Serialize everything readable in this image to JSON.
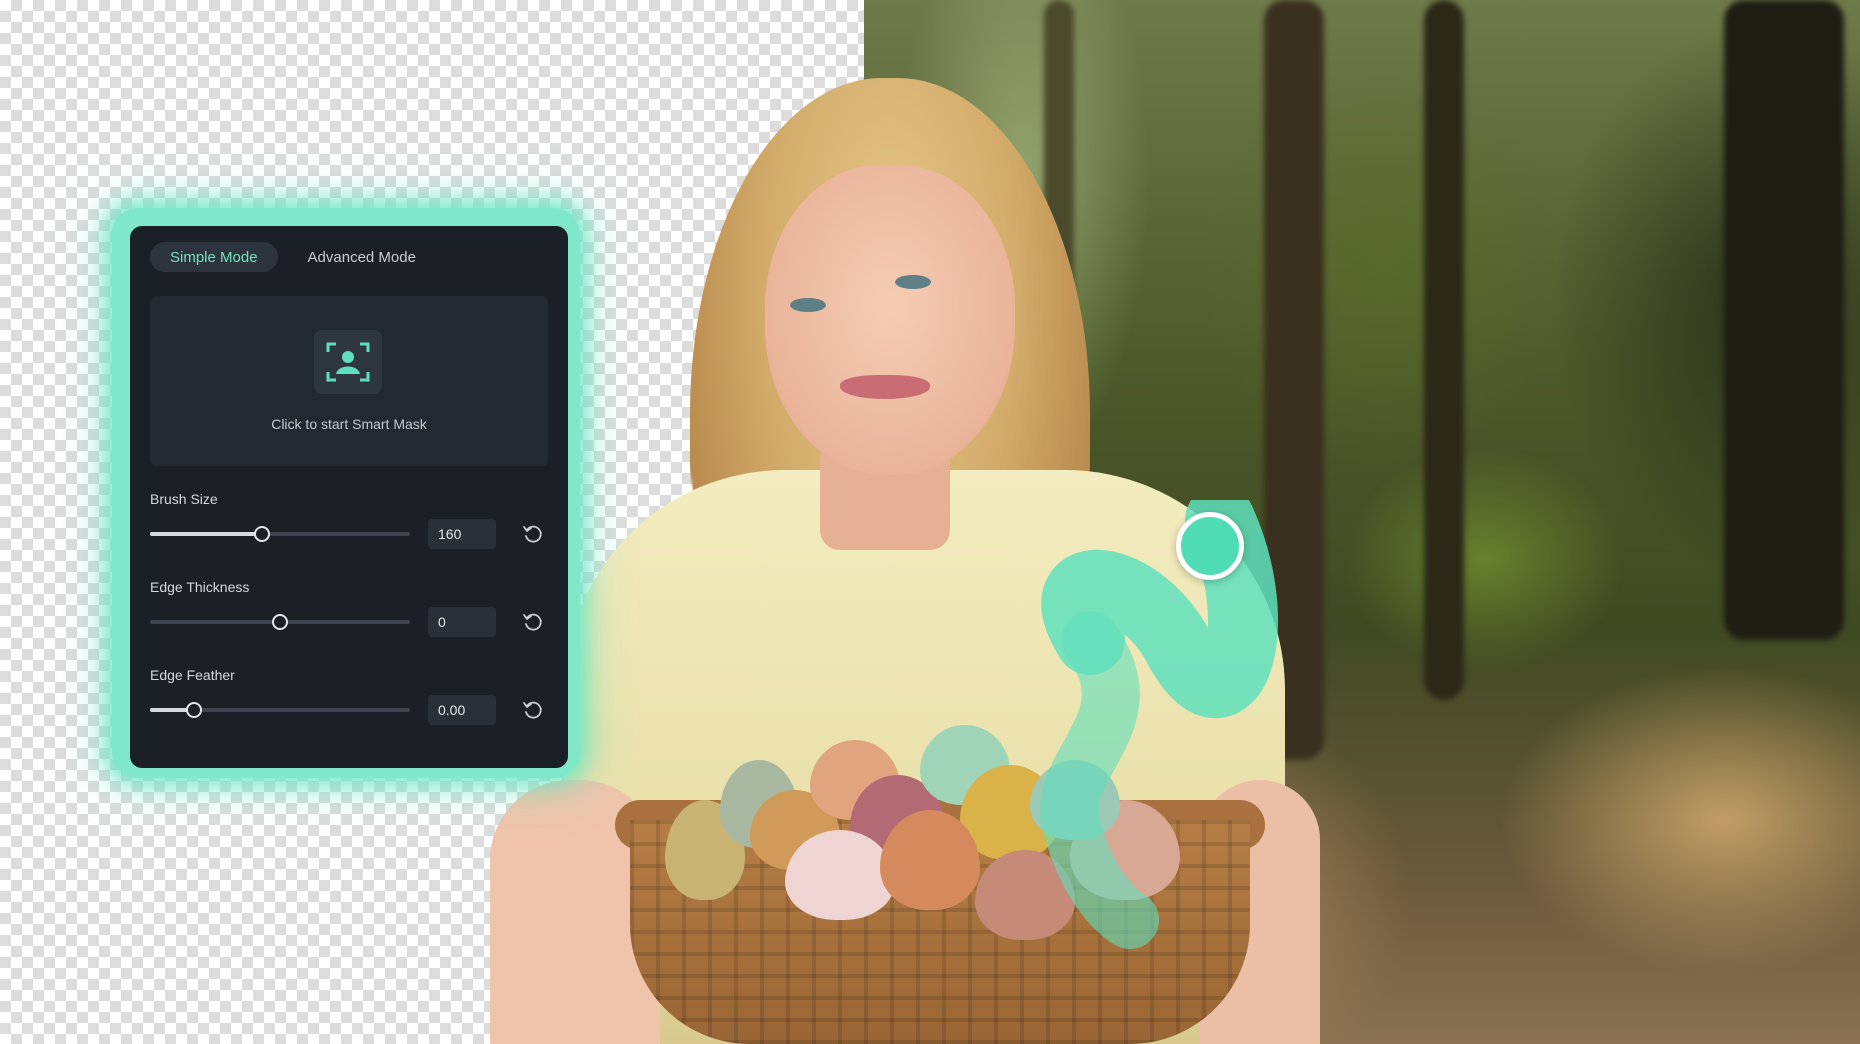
{
  "panel": {
    "tabs": [
      {
        "label": "Simple Mode",
        "active": true
      },
      {
        "label": "Advanced Mode",
        "active": false
      }
    ],
    "smart_mask": {
      "label": "Click to start Smart Mask",
      "icon": "person-frame-icon"
    },
    "sliders": [
      {
        "label": "Brush Size",
        "value": "160",
        "level": 0.43
      },
      {
        "label": "Edge Thickness",
        "value": "0",
        "level": 0.5
      },
      {
        "label": "Edge Feather",
        "value": "0.00",
        "level": 0.17
      }
    ],
    "reset_icon": "reset-icon"
  },
  "colors": {
    "accent": "#6fe3c1",
    "panel_bg": "#1b2027",
    "glow": "#7ee8c9",
    "brush_stroke": "#5fe0bd"
  }
}
